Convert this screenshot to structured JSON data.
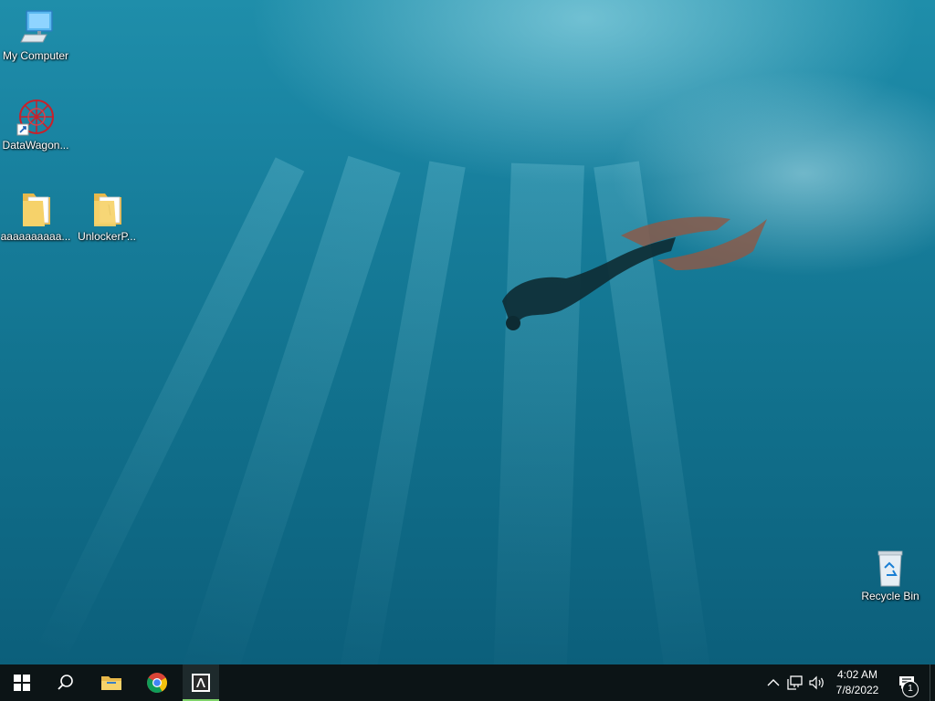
{
  "desktop": {
    "icons": [
      {
        "label": "My Computer",
        "icon": "computer-icon"
      },
      {
        "label": "DataWagon...",
        "icon": "datawagon-shortcut-icon"
      },
      {
        "label": "aaaaaaaaaa...",
        "icon": "folder-icon"
      },
      {
        "label": "UnlockerP...",
        "icon": "folder-icon"
      },
      {
        "label": "Recycle Bin",
        "icon": "recycle-bin-icon"
      }
    ]
  },
  "taskbar": {
    "apps": [
      {
        "name": "start",
        "icon": "windows-logo-icon"
      },
      {
        "name": "search",
        "icon": "search-icon"
      },
      {
        "name": "file-explorer",
        "icon": "folder-icon"
      },
      {
        "name": "chrome",
        "icon": "chrome-icon"
      },
      {
        "name": "adobe-app",
        "icon": "adobe-icon",
        "active": true
      }
    ],
    "tray": {
      "icons": [
        "chevron-up-icon",
        "network-icon",
        "volume-icon"
      ],
      "time": "4:02 AM",
      "date": "7/8/2022",
      "notification_count": "1"
    }
  },
  "colors": {
    "taskbar_bg": "#0c1416",
    "active_indicator": "#7fd36a",
    "wallpaper_primary": "#167c99"
  }
}
